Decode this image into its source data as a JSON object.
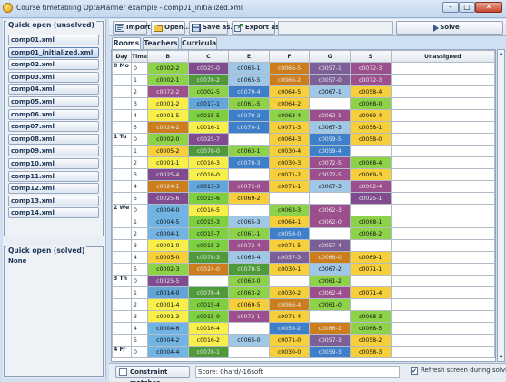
{
  "window": {
    "title": "Course timetabling OptaPlanner example - comp01_initialized.xml",
    "minimize": "–",
    "maximize": "□",
    "close": "✕"
  },
  "left": {
    "unsolved_title": "Quick open (unsolved)",
    "unsolved_files": [
      "comp01.xml",
      "comp01_initialized.xml",
      "comp02.xml",
      "comp03.xml",
      "comp04.xml",
      "comp05.xml",
      "comp06.xml",
      "comp07.xml",
      "comp08.xml",
      "comp09.xml",
      "comp10.xml",
      "comp11.xml",
      "comp12.xml",
      "comp13.xml",
      "comp14.xml"
    ],
    "selected_file": "comp01_initialized.xml",
    "solved_title": "Quick open (solved)",
    "solved_none": "None"
  },
  "toolbar": {
    "import_label": "Import...",
    "open_label": "Open...",
    "saveas_label": "Save as...",
    "export_label": "Export as...",
    "solve_label": "Solve"
  },
  "tabs": [
    "Rooms",
    "Teachers",
    "Curricula"
  ],
  "table": {
    "headers": [
      "Day",
      "Time",
      "B",
      "C",
      "E",
      "F",
      "G",
      "S",
      "Unassigned"
    ],
    "colors": {
      "c0001": "#f8ef4a",
      "c0002": "#8ed24a",
      "c0004": "#71b4e3",
      "c0005": "#f7cf3a",
      "c0006": "#53a8d9",
      "c0008": "#6fc23f",
      "c0014": "#62a4d6",
      "c0015": "#7fd03f",
      "c0016": "#f8ef4a",
      "c0017": "#63a6dc",
      "c0024": "#cd7e1c",
      "c0025": "#814c8f",
      "c0030": "#f7cf3a",
      "c0057": "#7c5f97",
      "c0058": "#f7cf3a",
      "c0059": "#3d7fc8",
      "c0061": "#8ed24a",
      "c0062": "#9c4f8d",
      "c0063": "#8ed24a",
      "c0064": "#f7cf3a",
      "c0066": "#cd7e1c",
      "c0068": "#8ed24a",
      "c0069": "#f7cf3a",
      "c0070": "#3d7fc8",
      "c0071": "#f7cf3a",
      "c0072": "#9c4f8d",
      "c0078": "#4f9b3a",
      "c0079": "#3d7fc8"
    },
    "dark_prefixes": [
      "c0025",
      "c0057",
      "c0059",
      "c0062",
      "c0066",
      "c0070",
      "c0072",
      "c0079",
      "c0024",
      "c0078",
      "c0006"
    ],
    "rows": [
      {
        "day": "0 Mo",
        "time": "0",
        "cells": [
          "c0002-2",
          "c0025-0",
          "c0065-1",
          "c0066-5",
          "c0057-1",
          "c0072-3",
          ""
        ]
      },
      {
        "day": "",
        "time": "1",
        "cells": [
          "c0002-1",
          "c0078-2",
          "c0065-5",
          "c0066-2",
          "c0057-0",
          "c0072-3",
          ""
        ]
      },
      {
        "day": "",
        "time": "2",
        "cells": [
          "c0072-2",
          "c0002-5",
          "c0070-4",
          "c0064-5",
          "c0067-1",
          "c0058-4",
          ""
        ]
      },
      {
        "day": "",
        "time": "3",
        "cells": [
          "c0001-2",
          "c0017-1",
          "c0061-5",
          "c0064-2",
          "",
          "c0068-0",
          ""
        ]
      },
      {
        "day": "",
        "time": "4",
        "cells": [
          "c0001-5",
          "c0015-5",
          "c0070-2",
          "c0063-4",
          "c0062-1",
          "c0069-4",
          ""
        ]
      },
      {
        "day": "",
        "time": "5",
        "cells": [
          "c0024-2",
          "c0016-1",
          "c0070-1",
          "c0071-3",
          "c0067-3",
          "c0058-1",
          ""
        ]
      },
      {
        "day": "1 Tu",
        "time": "0",
        "cells": [
          "c0002-0",
          "c0025-7",
          "",
          "c0064-3",
          "c0059-5",
          "c0058-0",
          ""
        ]
      },
      {
        "day": "",
        "time": "1",
        "cells": [
          "c0005-2",
          "c0078-0",
          "c0063-1",
          "c0030-4",
          "c0059-4",
          "",
          ""
        ]
      },
      {
        "day": "",
        "time": "2",
        "cells": [
          "c0001-1",
          "c0016-3",
          "c0070-3",
          "c0030-3",
          "c0072-5",
          "c0068-4",
          ""
        ]
      },
      {
        "day": "",
        "time": "3",
        "cells": [
          "c0025-4",
          "c0016-0",
          "",
          "c0071-2",
          "c0072-5",
          "c0069-3",
          ""
        ]
      },
      {
        "day": "",
        "time": "4",
        "cells": [
          "c0024-1",
          "c0017-3",
          "c0072-0",
          "c0071-1",
          "c0067-3",
          "c0062-4",
          ""
        ]
      },
      {
        "day": "",
        "time": "5",
        "cells": [
          "c0025-6",
          "c0015-6",
          "c0069-2",
          "",
          "",
          "c0025-1",
          ""
        ]
      },
      {
        "day": "2 We",
        "time": "0",
        "cells": [
          "c0004-0",
          "c0016-5",
          "",
          "c0063-3",
          "c0062-3",
          "",
          ""
        ]
      },
      {
        "day": "",
        "time": "1",
        "cells": [
          "c0004-5",
          "c0015-3",
          "c0065-3",
          "c0064-1",
          "c0062-0",
          "c0068-1",
          ""
        ]
      },
      {
        "day": "",
        "time": "2",
        "cells": [
          "c0004-1",
          "c0015-7",
          "c0061-1",
          "c0059-0",
          "",
          "c0068-2",
          ""
        ]
      },
      {
        "day": "",
        "time": "3",
        "cells": [
          "c0001-0",
          "c0015-2",
          "c0072-4",
          "c0071-5",
          "c0057-4",
          "",
          ""
        ]
      },
      {
        "day": "",
        "time": "4",
        "cells": [
          "c0005-0",
          "c0078-3",
          "c0065-4",
          "c0057-3",
          "c0066-0",
          "c0069-1",
          ""
        ]
      },
      {
        "day": "",
        "time": "5",
        "cells": [
          "c0002-3",
          "c0024-0",
          "c0078-5",
          "c0030-1",
          "c0067-2",
          "c0071-1",
          ""
        ]
      },
      {
        "day": "3 Th",
        "time": "0",
        "cells": [
          "c0025-5",
          "",
          "c0063-0",
          "",
          "c0061-2",
          "",
          ""
        ]
      },
      {
        "day": "",
        "time": "1",
        "cells": [
          "c0014-0",
          "c0078-4",
          "c0063-2",
          "c0030-2",
          "c0062-4",
          "c0071-4",
          ""
        ]
      },
      {
        "day": "",
        "time": "2",
        "cells": [
          "c0001-4",
          "c0015-4",
          "c0069-5",
          "c0066-4",
          "c0061-0",
          "",
          ""
        ]
      },
      {
        "day": "",
        "time": "3",
        "cells": [
          "c0001-3",
          "c0015-0",
          "c0072-1",
          "c0071-4",
          "",
          "c0068-3",
          ""
        ]
      },
      {
        "day": "",
        "time": "4",
        "cells": [
          "c0004-6",
          "c0016-4",
          "",
          "c0059-2",
          "c0066-1",
          "c0068-5",
          ""
        ]
      },
      {
        "day": "",
        "time": "5",
        "cells": [
          "c0004-2",
          "c0016-2",
          "c0065-0",
          "c0071-0",
          "c0057-3",
          "c0058-2",
          ""
        ]
      },
      {
        "day": "4 Fr",
        "time": "0",
        "cells": [
          "c0004-4",
          "c0078-1",
          "",
          "c0030-0",
          "c0059-3",
          "c0058-3",
          ""
        ]
      }
    ]
  },
  "status": {
    "constraint_label": "Constraint matches",
    "score": "Score: 0hard/-16soft",
    "refresh_label": "Refresh screen during solving",
    "refresh_checked": "✔"
  }
}
